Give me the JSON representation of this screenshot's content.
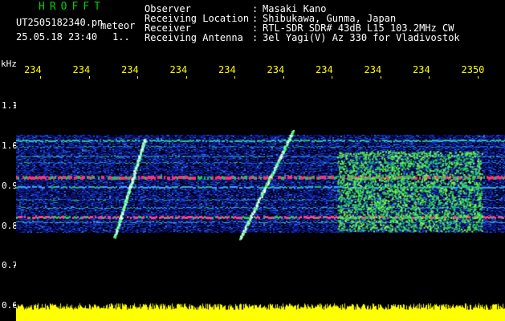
{
  "header": {
    "brand": "HROFFT",
    "filename": "UT2505182340.pn",
    "mode": "meteor",
    "datetime": "25.05.18 23:40",
    "counter": "1.."
  },
  "info": {
    "labels": [
      "Observer",
      "Receiving Location",
      "Receiver",
      "Receiving Antenna"
    ],
    "separator": ":",
    "values": [
      "Masaki Kano",
      "Shibukawa, Gunma, Japan",
      "RTL-SDR SDR# 43dB L15 103.2MHz CW",
      "3el Yagi(V) Az 330 for Vladivostok"
    ]
  },
  "axes": {
    "y_unit": "kHz",
    "y_ticks": [
      "1.1",
      "1.0",
      "0.9",
      "0.8",
      "0.7",
      "0.6"
    ],
    "x_ticks": [
      "234",
      "234",
      "234",
      "234",
      "234",
      "234",
      "234",
      "234",
      "234",
      "2350"
    ]
  },
  "colors": {
    "background": "#000000",
    "header_brand": "#00d000",
    "axis_labels": "#ffff00",
    "signal_strong": "#ff3070",
    "signal_mid": "#20c060",
    "noise": "#1030c0",
    "power_bar": "#ffff00"
  }
}
